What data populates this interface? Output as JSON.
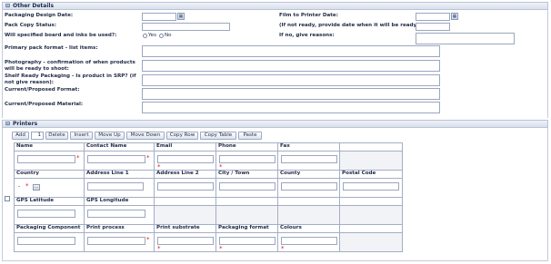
{
  "other_details": {
    "title": "Other Details",
    "toggle": "⊟",
    "packaging_design_date": "Packaging Design Date:",
    "film_to_printer_date": "Film to Printer Date:",
    "pack_copy_status": "Pack Copy Status:",
    "if_not_ready": "(If not ready, provide date when it will be ready)",
    "board_inks": "Will specified board and inks be used?:",
    "yes": "Yes",
    "no": "No",
    "if_no_reasons": "If no, give reasons:",
    "primary_pack_format": "Primary pack format - list items:",
    "photography": "Photography - confirmation of when products will be ready to shoot:",
    "shelf_ready": "Shelf Ready Packaging - Is product in SRP? (if not give reason):",
    "current_format": "Current/Proposed Format:",
    "current_material": "Current/Proposed Material:"
  },
  "printers": {
    "title": "Printers",
    "toggle": "⊟",
    "toolbar": {
      "add": "Add",
      "count": "1",
      "delete": "Delete",
      "insert": "Insert",
      "move_up": "Move Up",
      "move_down": "Move Down",
      "copy_row": "Copy Row",
      "copy_table": "Copy Table",
      "paste": "Paste"
    },
    "columns_row1": [
      "Name",
      "Contact Name",
      "Email",
      "Phone",
      "Fax"
    ],
    "columns_row2": [
      "Country",
      "Address Line 1",
      "Address Line 2",
      "City / Town",
      "County",
      "Postal Code"
    ],
    "columns_row3": [
      "GPS Latitude",
      "GPS Longitude"
    ],
    "columns_row4": [
      "Packaging Component",
      "Print process",
      "Print substrate",
      "Packaging format",
      "Colours"
    ],
    "country_value": "-",
    "lookup_label": "..."
  },
  "colors": {
    "header_bg": "#dde3ee",
    "border": "#a4aec4",
    "required": "#d62020"
  }
}
